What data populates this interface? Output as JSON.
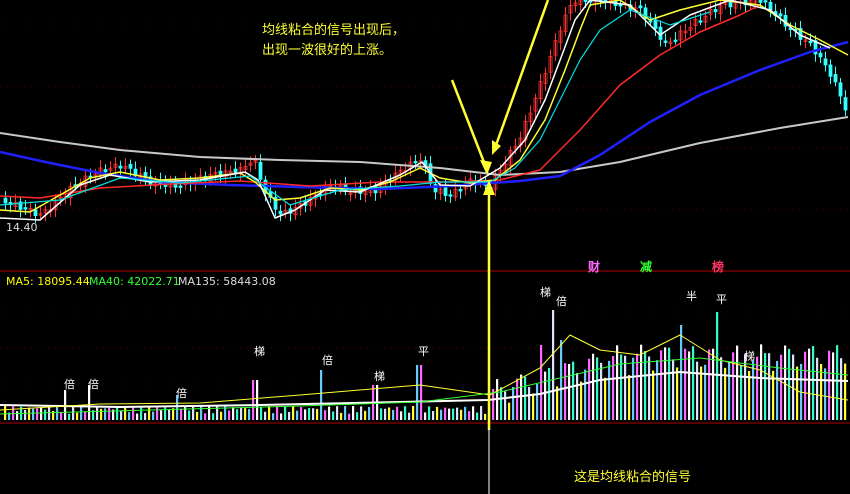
{
  "annotations": {
    "top_line1": "均线粘合的信号出现后，",
    "top_line2": "出现一波很好的上涨。",
    "bottom": "这是均线粘合的信号"
  },
  "price_panel": {
    "low_price_label": "14.40",
    "signals": [
      {
        "text": "财",
        "color": "#ff66ff"
      },
      {
        "text": "减",
        "color": "#33ff33"
      },
      {
        "text": "榜",
        "color": "#ff3366"
      }
    ],
    "ma_colors": {
      "ma_slow_gray": "#c8c8c8",
      "ma_blue": "#2020ff",
      "ma_red": "#ff2a2a",
      "ma_yellow": "#ffff33",
      "ma_white": "#ffffff",
      "ma_cyan": "#00e0e0",
      "candle_up": "#ff3333",
      "candle_down": "#33ffff"
    }
  },
  "volume_panel": {
    "ma_labels": [
      {
        "name": "MA5",
        "value": "18095.44",
        "color": "#ffff00"
      },
      {
        "name": "MA40",
        "value": "42022.71",
        "color": "#33ff33"
      },
      {
        "name": "MA135",
        "value": "58443.08",
        "color": "#dddddd"
      }
    ],
    "bar_labels": [
      "倍",
      "倍",
      "倍",
      "倍",
      "梯",
      "梯",
      "平",
      "梯",
      "倍",
      "半",
      "平",
      "梯"
    ]
  }
}
